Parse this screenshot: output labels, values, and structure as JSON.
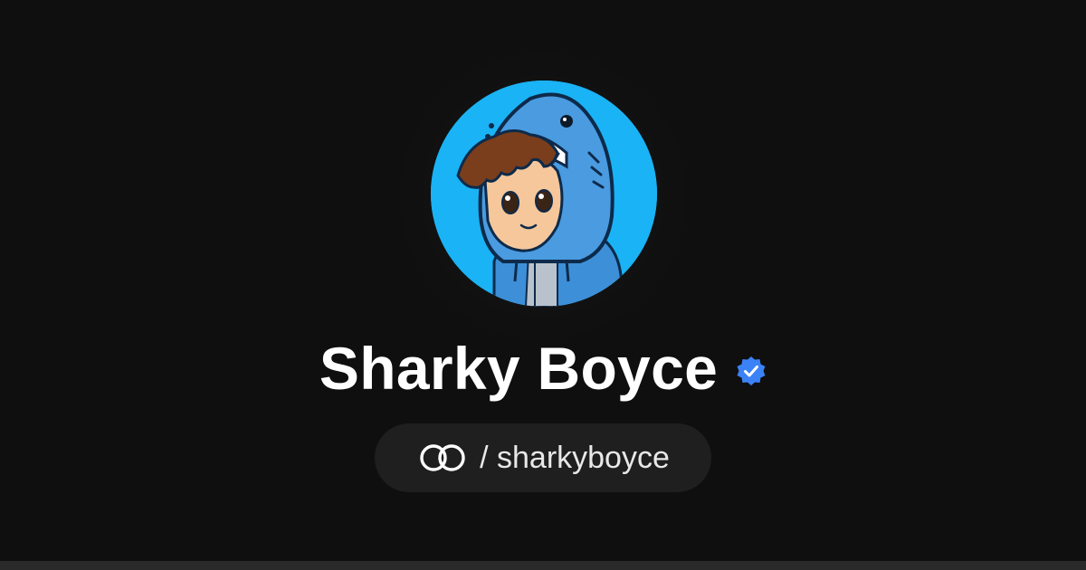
{
  "profile": {
    "display_name": "Sharky Boyce",
    "verified": true,
    "handle_separator": "/",
    "username": "sharkyboyce",
    "handle_text": "/ sharkyboyce",
    "avatar_description_icon": "shark-hoodie-avatar-icon"
  },
  "colors": {
    "background": "#0f0f0f",
    "pill_background": "#1f1f1f",
    "avatar_background": "#1ab3f5",
    "verified_badge": "#3b82f6",
    "text_primary": "#ffffff",
    "text_secondary": "#e8e8e8"
  },
  "icons": {
    "brand": "linked-rings-logo-icon",
    "verified": "verified-check-badge-icon"
  }
}
